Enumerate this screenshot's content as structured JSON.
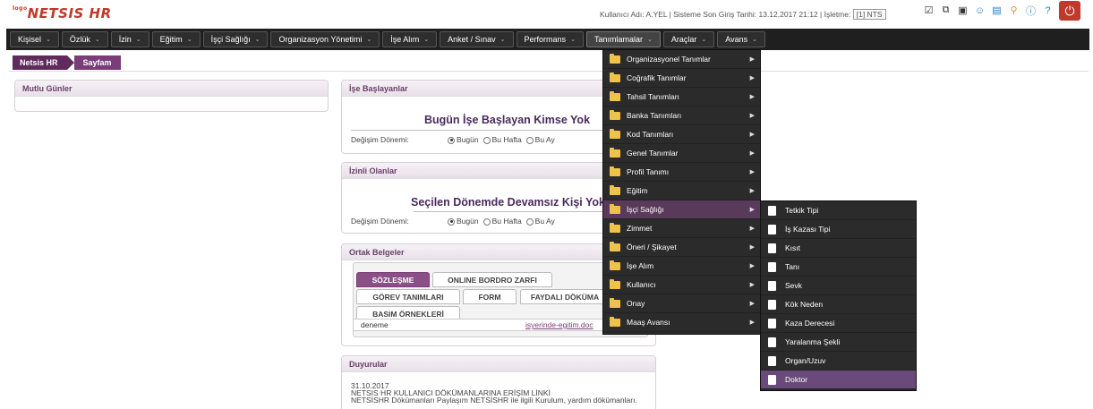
{
  "header": {
    "logo_small": "logo",
    "logo": "NETSIS HR",
    "user_info": "Kullanıcı Adı: A.YEL | Sisteme Son Giriş Tarihi: 13.12.2017 21:12 | İşletme:",
    "company": "[1] NTS",
    "icons": [
      "checkbox-icon",
      "external-link-icon",
      "monitor-icon",
      "users-icon",
      "chart-icon",
      "search-key-icon",
      "info-icon",
      "help-icon"
    ],
    "power_icon": "power-icon"
  },
  "menu": {
    "items": [
      "Kişisel",
      "Özlük",
      "İzin",
      "Eğitim",
      "İşçi Sağlığı",
      "Organizasyon Yönetimi",
      "İşe Alım",
      "Anket / Sınav",
      "Performans",
      "Tanımlamalar",
      "Araçlar",
      "Avans"
    ]
  },
  "breadcrumb": {
    "home": "Netsis HR",
    "current": "Sayfam"
  },
  "birthdays": {
    "title": "Mutlu Günler"
  },
  "starters": {
    "title": "İşe Başlayanlar",
    "message": "Bugün İşe Başlayan Kimse Yok",
    "period_label": "Değişim Dönemi:",
    "options": [
      "Bugün",
      "Bu Hafta",
      "Bu Ay"
    ],
    "selected": "Bugün"
  },
  "on_leave": {
    "title": "İzinli Olanlar",
    "message": "Seçilen Dönemde Devamsız Kişi Yok",
    "period_label": "Değişim Dönemi:",
    "options": [
      "Bugün",
      "Bu Hafta",
      "Bu Ay"
    ],
    "selected": "Bugün"
  },
  "documents": {
    "title": "Ortak Belgeler",
    "tabs_row1": [
      "SÖZLEŞME",
      "ONLINE BORDRO ZARFI"
    ],
    "tabs_row2": [
      "GÖREV TANIMLARI",
      "FORM",
      "FAYDALI DÖKÜMA"
    ],
    "tabs_row3": [
      "BASIM ÖRNEKLERİ"
    ],
    "row_name": "deneme",
    "row_link": "isyerinde-egitim.doc"
  },
  "announcements": {
    "title": "Duyurular",
    "date": "31.10.2017",
    "line1": "NETSIS HR KULLANICI DÖKÜMANLARINA ERİŞİM LİNKİ",
    "line2": "NETSİSHR Dökümanları Paylaşım NETSİSHR ile ilgili Kurulum, yardım dökümanları."
  },
  "definitions_menu": {
    "items": [
      "Organizasyonel Tanımlar",
      "Coğrafik Tanımlar",
      "Tahsil Tanımları",
      "Banka Tanımları",
      "Kod Tanımları",
      "Genel Tanımlar",
      "Profil Tanımı",
      "Eğitim",
      "İşçi Sağlığı",
      "Zimmet",
      "Öneri / Şikayet",
      "İşe Alım",
      "Kullanıcı",
      "Onay",
      "Maaş Avansı"
    ],
    "active": "İşçi Sağlığı"
  },
  "health_submenu": {
    "items": [
      "Tetkik Tipi",
      "İş Kazası Tipi",
      "Kısıt",
      "Tanı",
      "Sevk",
      "Kök Neden",
      "Kaza Derecesi",
      "Yaralanma Şekli",
      "Organ/Uzuv",
      "Doktor"
    ],
    "active": "Doktor"
  }
}
